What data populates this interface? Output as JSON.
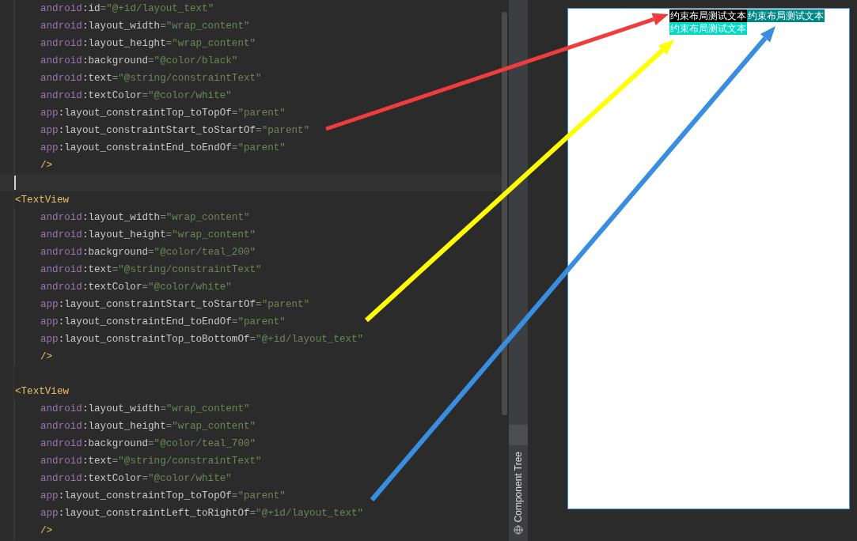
{
  "editor": {
    "lines": [
      {
        "children": [
          {
            "tokens": [
              {
                "kind": "ns",
                "text": "android"
              },
              {
                "kind": "attr",
                "text": ":id"
              },
              {
                "kind": "punct",
                "text": "="
              },
              {
                "kind": "str",
                "text": "\"@+id/layout_text\""
              }
            ]
          },
          {
            "tokens": [
              {
                "kind": "ns",
                "text": "android"
              },
              {
                "kind": "attr",
                "text": ":layout_width"
              },
              {
                "kind": "punct",
                "text": "="
              },
              {
                "kind": "str",
                "text": "\"wrap_content\""
              }
            ]
          },
          {
            "tokens": [
              {
                "kind": "ns",
                "text": "android"
              },
              {
                "kind": "attr",
                "text": ":layout_height"
              },
              {
                "kind": "punct",
                "text": "="
              },
              {
                "kind": "str",
                "text": "\"wrap_content\""
              }
            ]
          },
          {
            "tokens": [
              {
                "kind": "ns",
                "text": "android"
              },
              {
                "kind": "attr",
                "text": ":background"
              },
              {
                "kind": "punct",
                "text": "="
              },
              {
                "kind": "str",
                "text": "\"@color/black\""
              }
            ]
          },
          {
            "tokens": [
              {
                "kind": "ns",
                "text": "android"
              },
              {
                "kind": "attr",
                "text": ":text"
              },
              {
                "kind": "punct",
                "text": "="
              },
              {
                "kind": "str",
                "text": "\"@string/constraintText\""
              }
            ]
          },
          {
            "tokens": [
              {
                "kind": "ns",
                "text": "android"
              },
              {
                "kind": "attr",
                "text": ":textColor"
              },
              {
                "kind": "punct",
                "text": "="
              },
              {
                "kind": "str",
                "text": "\"@color/white\""
              }
            ]
          },
          {
            "tokens": [
              {
                "kind": "ns",
                "text": "app"
              },
              {
                "kind": "attr",
                "text": ":layout_constraintTop_toTopOf"
              },
              {
                "kind": "punct",
                "text": "="
              },
              {
                "kind": "str",
                "text": "\"parent\""
              }
            ]
          },
          {
            "tokens": [
              {
                "kind": "ns",
                "text": "app"
              },
              {
                "kind": "attr",
                "text": ":layout_constraintStart_toStartOf"
              },
              {
                "kind": "punct",
                "text": "="
              },
              {
                "kind": "str",
                "text": "\"parent\""
              }
            ]
          },
          {
            "tokens": [
              {
                "kind": "ns",
                "text": "app"
              },
              {
                "kind": "attr",
                "text": ":layout_constraintEnd_toEndOf"
              },
              {
                "kind": "punct",
                "text": "="
              },
              {
                "kind": "str",
                "text": "\"parent\""
              }
            ]
          },
          {
            "tokens": [
              {
                "kind": "tag",
                "text": "/>"
              }
            ]
          }
        ]
      },
      {
        "kind": "blank",
        "current": true
      },
      {
        "tokens": [
          {
            "kind": "tag",
            "text": "<TextView"
          }
        ],
        "children": [
          {
            "tokens": [
              {
                "kind": "ns",
                "text": "android"
              },
              {
                "kind": "attr",
                "text": ":layout_width"
              },
              {
                "kind": "punct",
                "text": "="
              },
              {
                "kind": "str",
                "text": "\"wrap_content\""
              }
            ]
          },
          {
            "tokens": [
              {
                "kind": "ns",
                "text": "android"
              },
              {
                "kind": "attr",
                "text": ":layout_height"
              },
              {
                "kind": "punct",
                "text": "="
              },
              {
                "kind": "str",
                "text": "\"wrap_content\""
              }
            ]
          },
          {
            "tokens": [
              {
                "kind": "ns",
                "text": "android"
              },
              {
                "kind": "attr",
                "text": ":background"
              },
              {
                "kind": "punct",
                "text": "="
              },
              {
                "kind": "str",
                "text": "\"@color/teal_200\""
              }
            ]
          },
          {
            "tokens": [
              {
                "kind": "ns",
                "text": "android"
              },
              {
                "kind": "attr",
                "text": ":text"
              },
              {
                "kind": "punct",
                "text": "="
              },
              {
                "kind": "str",
                "text": "\"@string/constraintText\""
              }
            ]
          },
          {
            "tokens": [
              {
                "kind": "ns",
                "text": "android"
              },
              {
                "kind": "attr",
                "text": ":textColor"
              },
              {
                "kind": "punct",
                "text": "="
              },
              {
                "kind": "str",
                "text": "\"@color/white\""
              }
            ]
          },
          {
            "tokens": [
              {
                "kind": "ns",
                "text": "app"
              },
              {
                "kind": "attr",
                "text": ":layout_constraintStart_toStartOf"
              },
              {
                "kind": "punct",
                "text": "="
              },
              {
                "kind": "str",
                "text": "\"parent\""
              }
            ]
          },
          {
            "tokens": [
              {
                "kind": "ns",
                "text": "app"
              },
              {
                "kind": "attr",
                "text": ":layout_constraintEnd_toEndOf"
              },
              {
                "kind": "punct",
                "text": "="
              },
              {
                "kind": "str",
                "text": "\"parent\""
              }
            ]
          },
          {
            "tokens": [
              {
                "kind": "ns",
                "text": "app"
              },
              {
                "kind": "attr",
                "text": ":layout_constraintTop_toBottomOf"
              },
              {
                "kind": "punct",
                "text": "="
              },
              {
                "kind": "str",
                "text": "\"@+id/layout_text\""
              }
            ]
          },
          {
            "tokens": [
              {
                "kind": "tag",
                "text": "/>"
              }
            ]
          }
        ]
      },
      {
        "kind": "blank"
      },
      {
        "tokens": [
          {
            "kind": "tag",
            "text": "<TextView"
          }
        ],
        "children": [
          {
            "tokens": [
              {
                "kind": "ns",
                "text": "android"
              },
              {
                "kind": "attr",
                "text": ":layout_width"
              },
              {
                "kind": "punct",
                "text": "="
              },
              {
                "kind": "str",
                "text": "\"wrap_content\""
              }
            ]
          },
          {
            "tokens": [
              {
                "kind": "ns",
                "text": "android"
              },
              {
                "kind": "attr",
                "text": ":layout_height"
              },
              {
                "kind": "punct",
                "text": "="
              },
              {
                "kind": "str",
                "text": "\"wrap_content\""
              }
            ]
          },
          {
            "tokens": [
              {
                "kind": "ns",
                "text": "android"
              },
              {
                "kind": "attr",
                "text": ":background"
              },
              {
                "kind": "punct",
                "text": "="
              },
              {
                "kind": "str",
                "text": "\"@color/teal_700\""
              }
            ]
          },
          {
            "tokens": [
              {
                "kind": "ns",
                "text": "android"
              },
              {
                "kind": "attr",
                "text": ":text"
              },
              {
                "kind": "punct",
                "text": "="
              },
              {
                "kind": "str",
                "text": "\"@string/constraintText\""
              }
            ]
          },
          {
            "tokens": [
              {
                "kind": "ns",
                "text": "android"
              },
              {
                "kind": "attr",
                "text": ":textColor"
              },
              {
                "kind": "punct",
                "text": "="
              },
              {
                "kind": "str",
                "text": "\"@color/white\""
              }
            ]
          },
          {
            "tokens": [
              {
                "kind": "ns",
                "text": "app"
              },
              {
                "kind": "attr",
                "text": ":layout_constraintTop_toTopOf"
              },
              {
                "kind": "punct",
                "text": "="
              },
              {
                "kind": "str",
                "text": "\"parent\""
              }
            ]
          },
          {
            "tokens": [
              {
                "kind": "ns",
                "text": "app"
              },
              {
                "kind": "attr",
                "text": ":layout_constraintLeft_toRightOf"
              },
              {
                "kind": "punct",
                "text": "="
              },
              {
                "kind": "str",
                "text": "\"@+id/layout_text\""
              }
            ]
          },
          {
            "tokens": [
              {
                "kind": "tag",
                "text": "/>"
              }
            ]
          }
        ]
      }
    ]
  },
  "side_tab": {
    "label": "Component Tree"
  },
  "preview": {
    "rows": [
      [
        {
          "text": "约束布局测试文本",
          "color": "#000000"
        },
        {
          "text": "约束布局测试文本",
          "color": "#018786"
        }
      ],
      [
        {
          "text": "约束布局测试文本",
          "color": "#03dac5"
        }
      ]
    ]
  },
  "annotations": [
    {
      "color": "#f03c3c"
    },
    {
      "color": "#ffff00"
    },
    {
      "color": "#3a8ee0"
    }
  ]
}
